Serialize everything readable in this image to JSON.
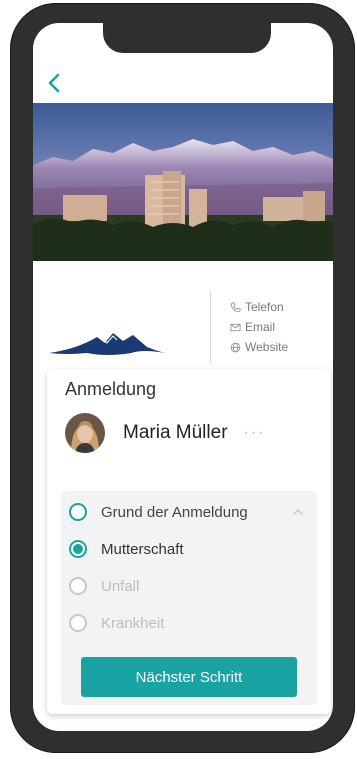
{
  "contacts": {
    "phone_label": "Telefon",
    "email_label": "Email",
    "website_label": "Website"
  },
  "card": {
    "title": "Anmeldung",
    "user_name": "Maria Müller",
    "more_label": "···"
  },
  "reason": {
    "header": "Grund der Anmeldung",
    "options": [
      {
        "label": "Mutterschaft",
        "selected": true
      },
      {
        "label": "Unfall",
        "selected": false
      },
      {
        "label": "Krankheit",
        "selected": false
      }
    ]
  },
  "actions": {
    "next_label": "Nächster Schritt"
  },
  "colors": {
    "accent": "#1aa3a3",
    "logo": "#1b3a73"
  },
  "icons": {
    "back": "chevron-left-icon",
    "phone": "phone-icon",
    "email": "mail-icon",
    "website": "globe-icon",
    "collapse": "chevron-up-icon"
  }
}
